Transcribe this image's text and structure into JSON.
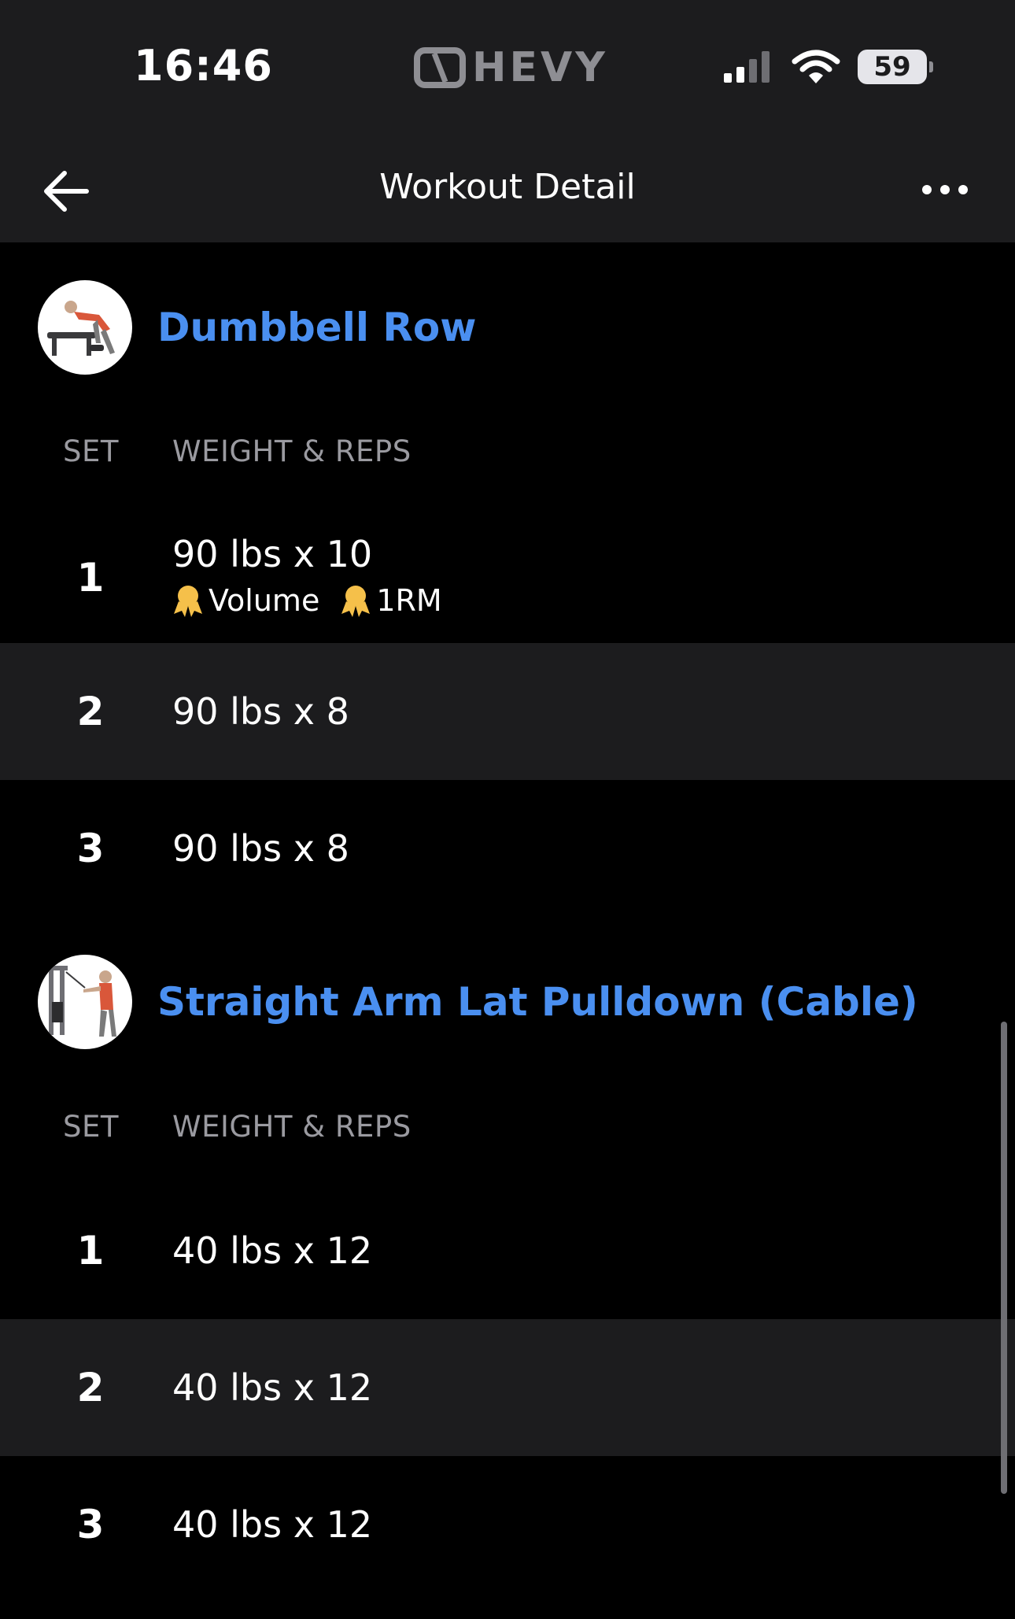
{
  "status": {
    "time": "16:46",
    "brand": "HEVY",
    "battery": "59"
  },
  "nav": {
    "title": "Workout Detail"
  },
  "columns": {
    "set": "SET",
    "weight_reps": "WEIGHT & REPS"
  },
  "exercises": [
    {
      "name": "Dumbbell Row",
      "sets": [
        {
          "num": "1",
          "value": "90 lbs x 10",
          "records": [
            "Volume",
            "1RM"
          ]
        },
        {
          "num": "2",
          "value": "90 lbs x 8"
        },
        {
          "num": "3",
          "value": "90 lbs x 8"
        }
      ]
    },
    {
      "name": "Straight Arm Lat Pulldown (Cable)",
      "sets": [
        {
          "num": "1",
          "value": "40 lbs x 12"
        },
        {
          "num": "2",
          "value": "40 lbs x 12"
        },
        {
          "num": "3",
          "value": "40 lbs x 12"
        }
      ]
    }
  ],
  "colors": {
    "accent": "#4a8ff0",
    "header_bg": "#1c1c1e",
    "row_alt_bg": "#1c1c1e",
    "medal": "#f5c04a"
  }
}
